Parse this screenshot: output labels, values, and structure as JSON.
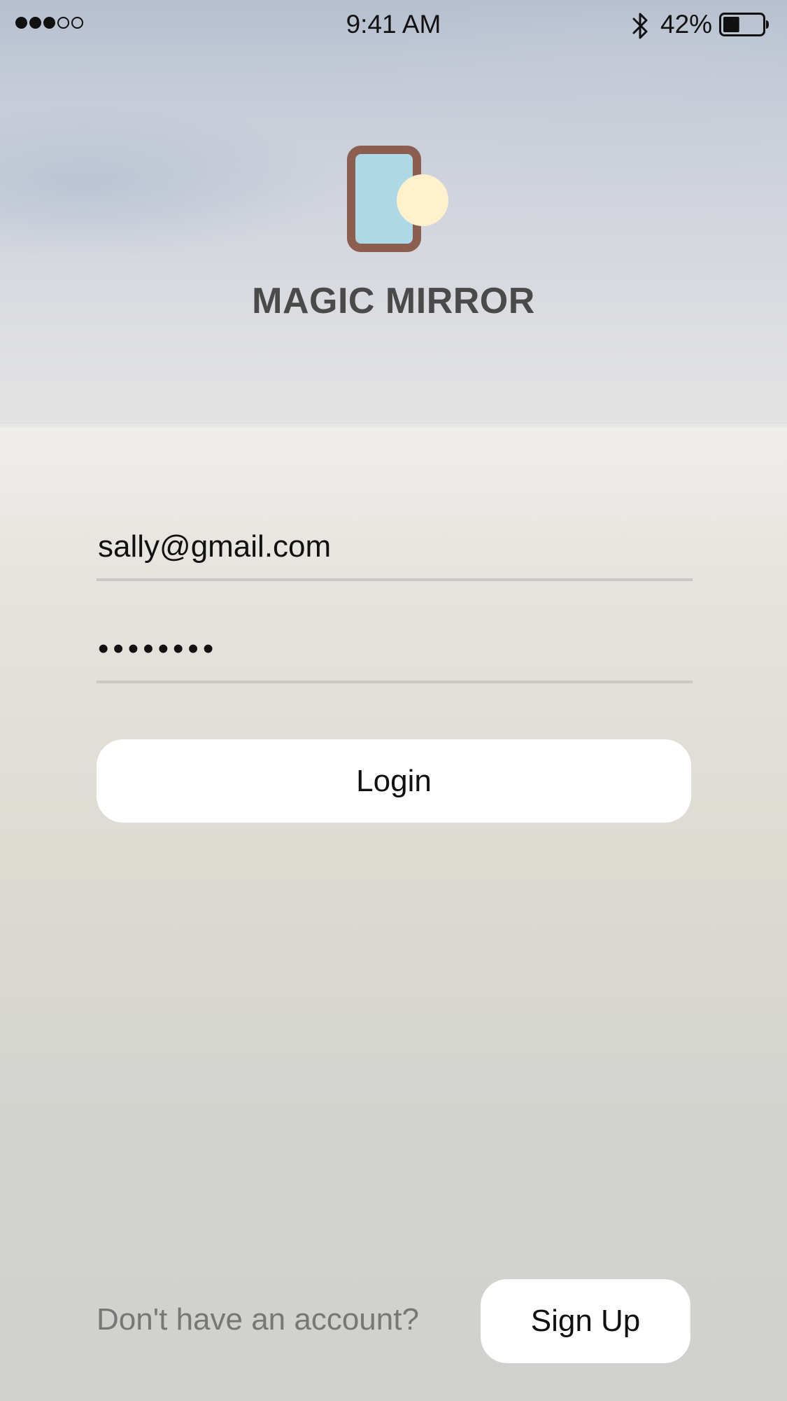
{
  "status_bar": {
    "signal_bars_filled": 3,
    "signal_bars_total": 5,
    "time": "9:41 AM",
    "bluetooth_icon": "bluetooth-icon",
    "battery_percent": "42%",
    "battery_level": 0.42
  },
  "app": {
    "title": "MAGIC MIRROR",
    "logo_icon": "mirror-logo-icon",
    "colors": {
      "logo_frame": "#8b5e4f",
      "logo_glass": "#add8e6",
      "logo_light": "#fff1cc"
    }
  },
  "form": {
    "email_value": "sally@gmail.com",
    "password_value": "••••••••",
    "login_label": "Login"
  },
  "footer": {
    "prompt": "Don't have an account?",
    "signup_label": "Sign Up"
  }
}
